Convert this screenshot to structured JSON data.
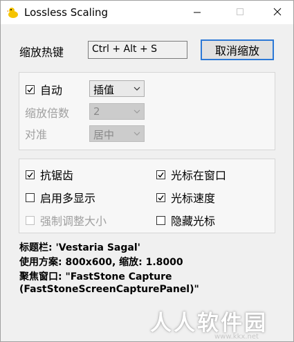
{
  "window": {
    "title": "Lossless Scaling",
    "buttons": {
      "minimize": "minimize",
      "maximize": "maximize",
      "close": "close"
    }
  },
  "hotkey": {
    "label": "缩放热键",
    "value": "Ctrl + Alt + S",
    "cancel_label": "取消缩放"
  },
  "scaling_group": {
    "auto": {
      "label": "自动",
      "checked": true
    },
    "mode_select": {
      "value": "插值"
    },
    "factor": {
      "label": "缩放倍数",
      "value": "2"
    },
    "align": {
      "label": "对准",
      "value": "居中"
    }
  },
  "options_group": {
    "antialias": {
      "label": "抗锯齿",
      "checked": true
    },
    "multi_display": {
      "label": "启用多显示",
      "checked": false
    },
    "force_resize": {
      "label": "强制调整大小",
      "checked": false
    },
    "cursor_in_window": {
      "label": "光标在窗口",
      "checked": true
    },
    "cursor_speed": {
      "label": "光标速度",
      "checked": true
    },
    "hide_cursor": {
      "label": "隐藏光标",
      "checked": false
    }
  },
  "info": {
    "line1": "标题栏: 'Vestaria Sagal'",
    "line2": "使用方案: 800x600, 缩放: 1.8000",
    "line3": "聚焦窗口: \"FastStone Capture",
    "line4": "(FastStoneScreenCapturePanel)\""
  },
  "watermark": {
    "text": "人人软件园",
    "url": "www.kkx.net"
  }
}
